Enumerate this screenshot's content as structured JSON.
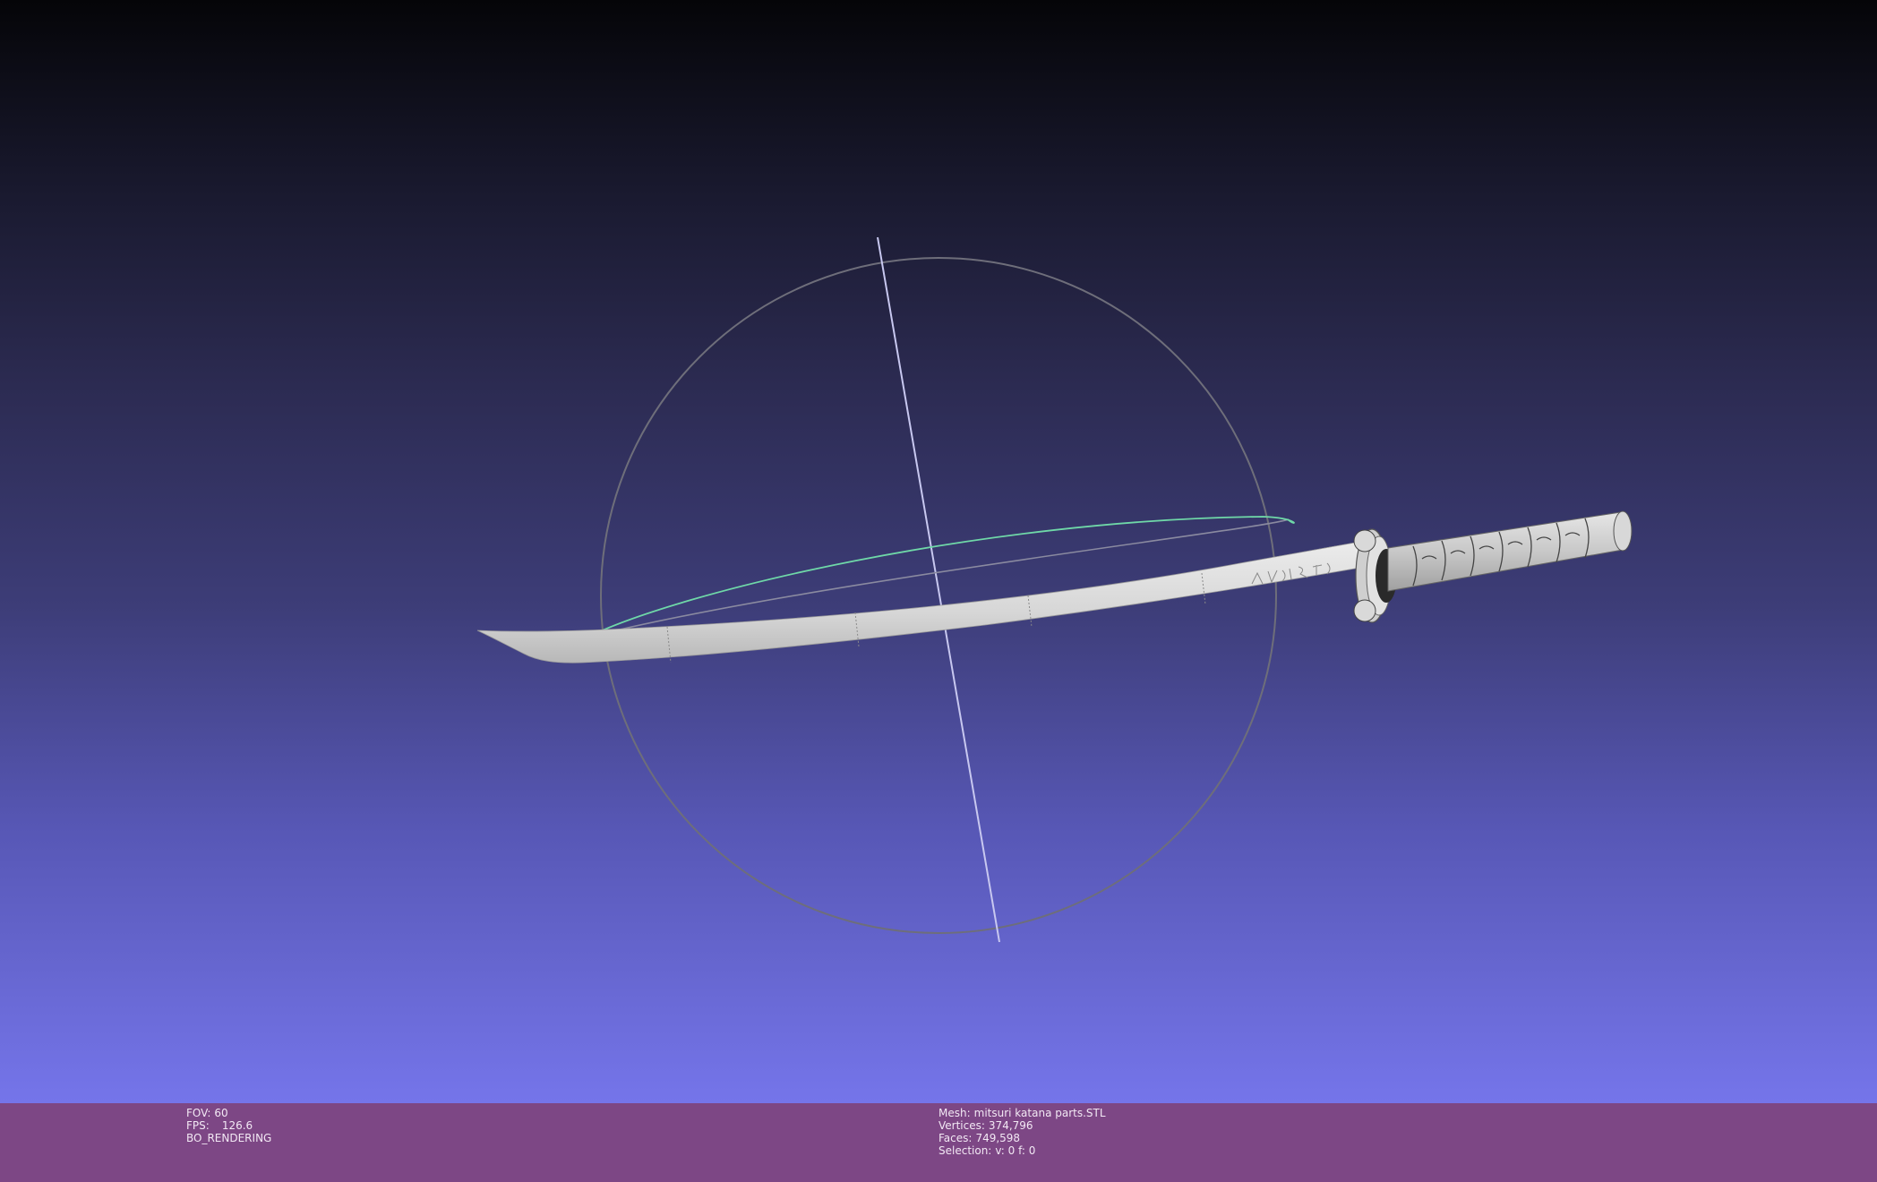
{
  "viewer": {
    "left_info": {
      "fov_label": "FOV:",
      "fov_value": "60",
      "fps_label": "FPS:",
      "fps_value": "126.6",
      "render_mode": "BO_RENDERING"
    },
    "mesh_info": {
      "mesh_label": "Mesh:",
      "mesh_name": "mitsuri katana parts.STL",
      "vertices_label": "Vertices:",
      "vertices_value": "374,796",
      "faces_label": "Faces:",
      "faces_value": "749,598",
      "selection_label": "Selection:",
      "selection_value": "v: 0 f: 0"
    },
    "colors": {
      "status_bar": "#7d4785",
      "background_top": "#050508",
      "background_bottom": "#7575ea",
      "trackball_circle": "#6e6e7a",
      "trackball_axis_vertical": "#c8c8f0",
      "trackball_axis_horizontal": "#6fd8a8",
      "blade": "#d9d9d9",
      "handle": "#cfcfcf"
    },
    "model": {
      "type": "3d-mesh",
      "object": "katana",
      "icons": [
        "trackball-icon"
      ]
    }
  }
}
